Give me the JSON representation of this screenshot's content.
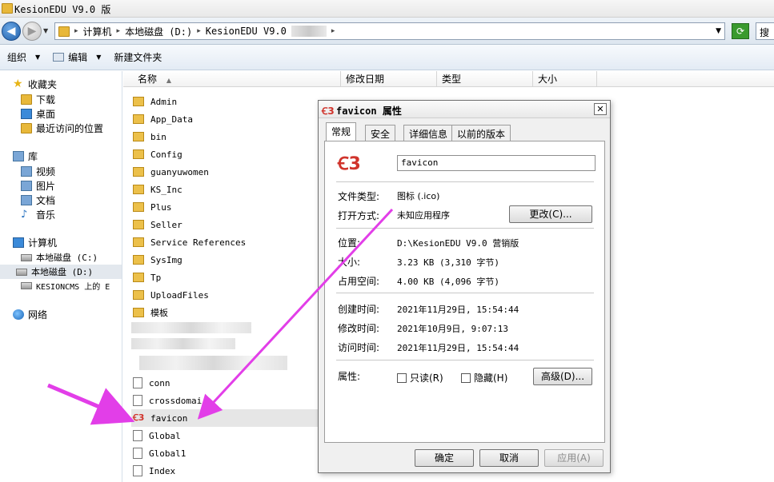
{
  "window": {
    "title": "KesionEDU V9.0 版"
  },
  "address": {
    "crumbs": [
      "计算机",
      "本地磁盘 (D:)",
      "KesionEDU V9.0"
    ],
    "search_placeholder": "搜"
  },
  "toolbar": {
    "organize": "组织",
    "edit": "编辑",
    "new_folder": "新建文件夹"
  },
  "sidebar": {
    "favorites": "收藏夹",
    "downloads": "下载",
    "desktop": "桌面",
    "recent": "最近访问的位置",
    "libraries": "库",
    "videos": "视频",
    "pictures": "图片",
    "documents": "文档",
    "music": "音乐",
    "computer": "计算机",
    "drive_c": "本地磁盘 (C:)",
    "drive_d": "本地磁盘 (D:)",
    "network_drive": "KESIONCMS 上的 E",
    "network": "网络"
  },
  "columns": {
    "name": "名称",
    "modified": "修改日期",
    "type": "类型",
    "size": "大小"
  },
  "files": {
    "f1": "Admin",
    "f2": "App_Data",
    "f3": "bin",
    "f4": "Config",
    "f5": "guanyuwomen",
    "f6": "KS_Inc",
    "f7": "Plus",
    "f8": "Seller",
    "f9": "Service References",
    "f10": "SysImg",
    "f11": "Tp",
    "f12": "UploadFiles",
    "f13": "模板",
    "f14": "conn",
    "f15": "crossdomai",
    "f16": "favicon",
    "f17": "Global",
    "f18": "Global1",
    "f19": "Index"
  },
  "dialog": {
    "title_name": "favicon",
    "title_suffix": "属性",
    "tabs": {
      "general": "常规",
      "security": "安全",
      "details": "详细信息",
      "previous": "以前的版本"
    },
    "filename": "favicon",
    "labels": {
      "file_type": "文件类型:",
      "opens_with": "打开方式:",
      "location": "位置:",
      "size": "大小:",
      "size_on_disk": "占用空间:",
      "created": "创建时间:",
      "modified": "修改时间:",
      "accessed": "访问时间:",
      "attributes": "属性:"
    },
    "values": {
      "file_type": "图标 (.ico)",
      "opens_with": "未知应用程序",
      "location": "D:\\KesionEDU V9.0 营销版",
      "size": "3.23 KB (3,310 字节)",
      "size_on_disk": "4.00 KB (4,096 字节)",
      "created": "2021年11月29日, 15:54:44",
      "modified": "2021年10月9日, 9:07:13",
      "accessed": "2021年11月29日, 15:54:44"
    },
    "buttons": {
      "change": "更改(C)...",
      "readonly": "只读(R)",
      "hidden": "隐藏(H)",
      "advanced": "高级(D)...",
      "ok": "确定",
      "cancel": "取消",
      "apply": "应用(A)"
    }
  },
  "colors": {
    "arrow": "#e23ee8",
    "accent": "#1f5fa8"
  }
}
